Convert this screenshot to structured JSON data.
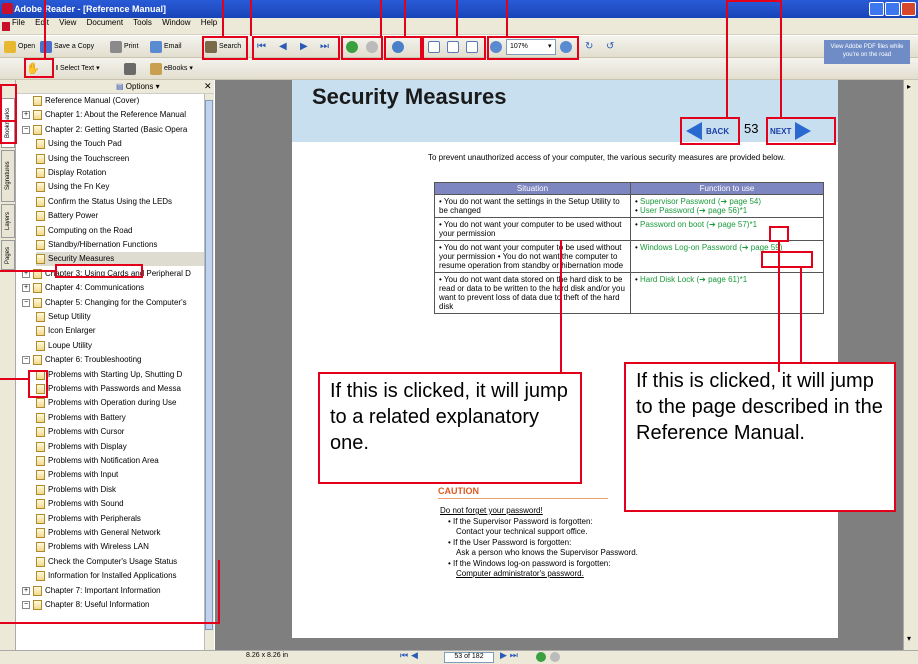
{
  "window": {
    "title": "Adobe Reader - [Reference Manual]"
  },
  "menu": [
    "File",
    "Edit",
    "View",
    "Document",
    "Tools",
    "Window",
    "Help"
  ],
  "toolbar1": {
    "open": "Open",
    "save_copy": "Save a Copy",
    "print": "Print",
    "email": "Email",
    "search": "Search",
    "zoom": "107%"
  },
  "toolbar2": {
    "select_text": "Select Text",
    "ebooks": "eBooks"
  },
  "adobe_promo": "View Adobe PDF files while you're on the road",
  "sidebar": {
    "options": "Options",
    "tabs": [
      "Bookmarks",
      "Signatures",
      "Layers",
      "Pages"
    ],
    "items": [
      {
        "label": "Reference Manual (Cover)",
        "level": 0,
        "toggle": ""
      },
      {
        "label": "Chapter 1: About the Reference Manual",
        "level": 0,
        "toggle": "+"
      },
      {
        "label": "Chapter 2: Getting Started (Basic Opera",
        "level": 0,
        "toggle": "−"
      },
      {
        "label": "Using the Touch Pad",
        "level": 1,
        "toggle": ""
      },
      {
        "label": "Using the Touchscreen",
        "level": 1,
        "toggle": ""
      },
      {
        "label": "Display Rotation",
        "level": 1,
        "toggle": ""
      },
      {
        "label": "Using the Fn Key",
        "level": 1,
        "toggle": ""
      },
      {
        "label": "Confirm the Status Using the LEDs",
        "level": 1,
        "toggle": ""
      },
      {
        "label": "Battery Power",
        "level": 1,
        "toggle": ""
      },
      {
        "label": "Computing on the Road",
        "level": 1,
        "toggle": ""
      },
      {
        "label": "Standby/Hibernation Functions",
        "level": 1,
        "toggle": ""
      },
      {
        "label": "Security Measures",
        "level": 1,
        "toggle": "",
        "selected": true
      },
      {
        "label": "Chapter 3: Using Cards and Peripheral D",
        "level": 0,
        "toggle": "+"
      },
      {
        "label": "Chapter 4: Communications",
        "level": 0,
        "toggle": "+"
      },
      {
        "label": "Chapter 5: Changing for the Computer's",
        "level": 0,
        "toggle": "−"
      },
      {
        "label": "Setup Utility",
        "level": 1,
        "toggle": ""
      },
      {
        "label": "Icon Enlarger",
        "level": 1,
        "toggle": ""
      },
      {
        "label": "Loupe Utility",
        "level": 1,
        "toggle": ""
      },
      {
        "label": "Chapter 6: Troubleshooting",
        "level": 0,
        "toggle": "−"
      },
      {
        "label": "Problems with Starting Up, Shutting D",
        "level": 1,
        "toggle": ""
      },
      {
        "label": "Problems with Passwords and Messa",
        "level": 1,
        "toggle": ""
      },
      {
        "label": "Problems with Operation during Use",
        "level": 1,
        "toggle": ""
      },
      {
        "label": "Problems with Battery",
        "level": 1,
        "toggle": ""
      },
      {
        "label": "Problems with Cursor",
        "level": 1,
        "toggle": ""
      },
      {
        "label": "Problems with Display",
        "level": 1,
        "toggle": ""
      },
      {
        "label": "Problems with Notification Area",
        "level": 1,
        "toggle": ""
      },
      {
        "label": "Problems with Input",
        "level": 1,
        "toggle": ""
      },
      {
        "label": "Problems with Disk",
        "level": 1,
        "toggle": ""
      },
      {
        "label": "Problems with Sound",
        "level": 1,
        "toggle": ""
      },
      {
        "label": "Problems with Peripherals",
        "level": 1,
        "toggle": ""
      },
      {
        "label": "Problems with General Network",
        "level": 1,
        "toggle": ""
      },
      {
        "label": "Problems with Wireless LAN",
        "level": 1,
        "toggle": ""
      },
      {
        "label": "Check the Computer's Usage Status",
        "level": 1,
        "toggle": ""
      },
      {
        "label": "Information for Installed Applications",
        "level": 1,
        "toggle": ""
      },
      {
        "label": "Chapter 7: Important Information",
        "level": 0,
        "toggle": "+"
      },
      {
        "label": "Chapter 8: Useful Information",
        "level": 0,
        "toggle": "−"
      }
    ]
  },
  "doc": {
    "heading": "Security Measures",
    "back": "BACK",
    "page_num": "53",
    "next": "NEXT",
    "intro": "To prevent unauthorized access of your computer, the various security measures are provided below.",
    "table": {
      "headers": [
        "Situation",
        "Function to use"
      ],
      "rows": [
        {
          "situation": "You do not want the settings in the Setup Utility to be changed",
          "functions": [
            "Supervisor Password (➔ page 54)",
            "User Password (➔ page 56)*1"
          ]
        },
        {
          "situation": "You do not want your computer to be used without your permission",
          "functions": [
            "Password on boot (➔ page 57)*1"
          ]
        },
        {
          "situation": "You do not want your computer to be used without your permission • You do not want the computer to resume operation from standby or hibernation mode",
          "functions": [
            "Windows Log-on Password (➔ page 59)"
          ]
        },
        {
          "situation": "You do not want data stored on the hard disk to be read or data to be written to the hard disk and/or you want to prevent loss of data due to theft of the hard disk",
          "functions": [
            "Hard Disk Lock (➔ page 61)*1"
          ]
        }
      ]
    },
    "caution": "CAUTION",
    "caution_items": [
      "Do not forget your password!",
      "• If the Supervisor Password is forgotten:",
      "Contact your technical support office.",
      "• If the User Password is forgotten:",
      "Ask a person who knows the Supervisor Password.",
      "• If the Windows log-on password is forgotten:",
      "Computer administrator's password."
    ]
  },
  "callouts": {
    "left": "If this is clicked, it will jump to a related explanatory one.",
    "right": "If this is clicked, it will jump to the page described in the Reference Manual."
  },
  "status": {
    "page_size": "8.26 x 8.26 in",
    "page_indicator": "53 of 182"
  }
}
